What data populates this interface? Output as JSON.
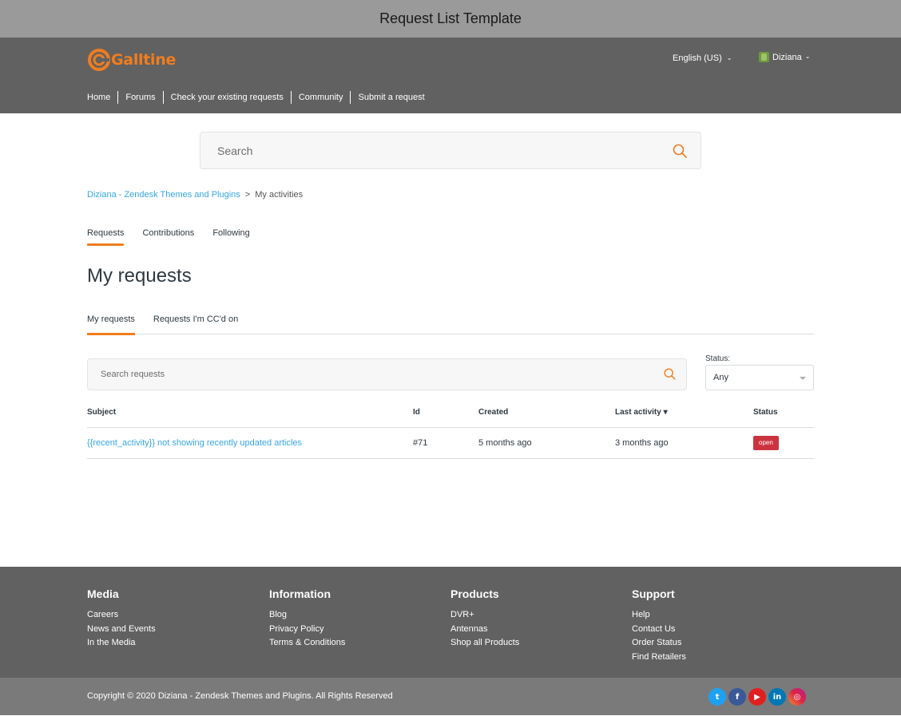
{
  "window": {
    "title": "Request List Template"
  },
  "header": {
    "logo_text": "Galltine",
    "language": "English (US)",
    "user_name": "Diziana"
  },
  "nav": {
    "items": [
      "Home",
      "Forums",
      "Check your existing requests",
      "Community",
      "Submit a request"
    ]
  },
  "search": {
    "placeholder": "Search"
  },
  "breadcrumb": {
    "parent": "Diziana - Zendesk Themes and Plugins",
    "separator": ">",
    "current": "My activities"
  },
  "activity_tabs": [
    "Requests",
    "Contributions",
    "Following"
  ],
  "page_title": "My requests",
  "request_tabs": [
    "My requests",
    "Requests I'm CC'd on"
  ],
  "request_search": {
    "placeholder": "Search requests"
  },
  "status_filter": {
    "label": "Status:",
    "value": "Any"
  },
  "table": {
    "headers": {
      "subject": "Subject",
      "id": "Id",
      "created": "Created",
      "last_activity": "Last activity ▾",
      "status": "Status"
    },
    "rows": [
      {
        "subject": "{{recent_activity}} not showing recently updated articles",
        "id": "#71",
        "created": "5 months ago",
        "last_activity": "3 months ago",
        "status": "open"
      }
    ]
  },
  "footer": {
    "columns": [
      {
        "title": "Media",
        "links": [
          "Careers",
          "News and Events",
          "In the Media"
        ]
      },
      {
        "title": "Information",
        "links": [
          "Blog",
          "Privacy Policy",
          "Terms & Conditions"
        ]
      },
      {
        "title": "Products",
        "links": [
          "DVR+",
          "Antennas",
          "Shop all Products"
        ]
      },
      {
        "title": "Support",
        "links": [
          "Help",
          "Contact Us",
          "Order Status",
          "Find Retailers"
        ]
      }
    ],
    "copyright": "Copyright © 2020 Diziana - Zendesk Themes and Plugins. All Rights Reserved",
    "socials": [
      {
        "icon": "twitter-icon",
        "glyph": "t"
      },
      {
        "icon": "facebook-icon",
        "glyph": "f"
      },
      {
        "icon": "youtube-icon",
        "glyph": "▶"
      },
      {
        "icon": "linkedin-icon",
        "glyph": "in"
      },
      {
        "icon": "instagram-icon",
        "glyph": "◎"
      }
    ]
  },
  "colors": {
    "accent": "#f07d1f",
    "link": "#36a6e2",
    "header_bg": "#616161",
    "status_open": "#cc3340"
  }
}
